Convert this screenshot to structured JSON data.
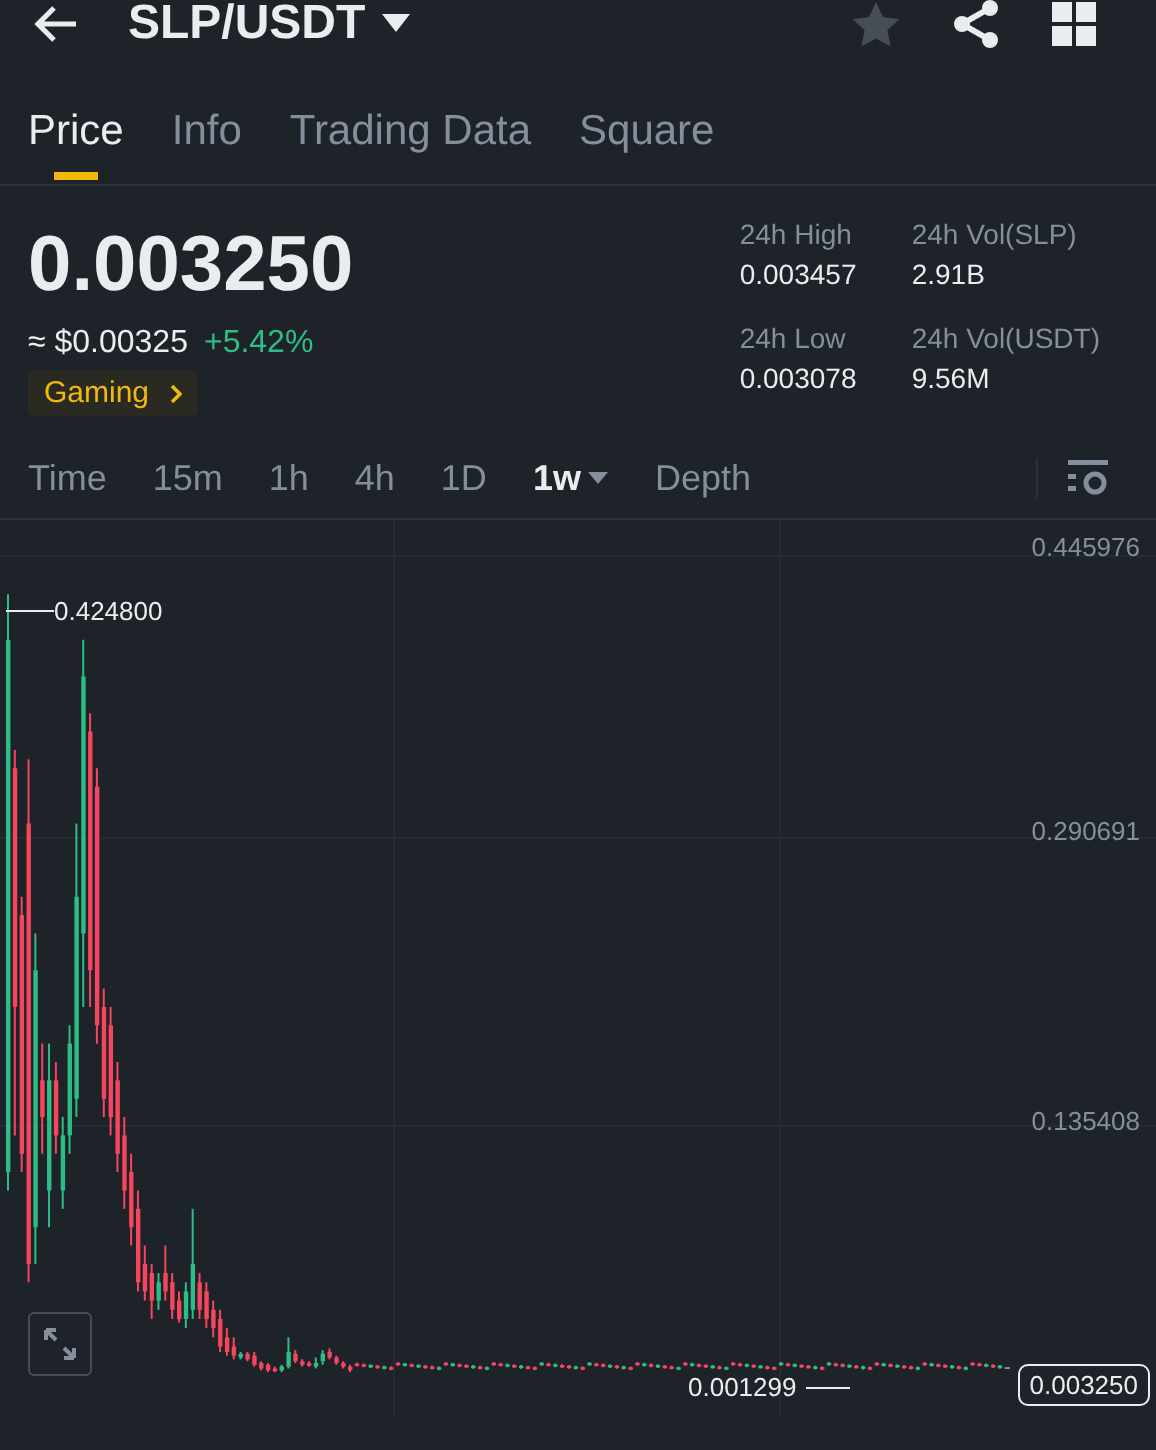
{
  "header": {
    "title": "SLP/USDT"
  },
  "tabs": [
    {
      "label": "Price",
      "selected": true
    },
    {
      "label": "Info",
      "selected": false
    },
    {
      "label": "Trading Data",
      "selected": false
    },
    {
      "label": "Square",
      "selected": false
    }
  ],
  "price": {
    "last": "0.003250",
    "fiat": "≈ $0.00325",
    "change": "+5.42%",
    "tag": "Gaming"
  },
  "stats": [
    {
      "label": "24h High",
      "value": "0.003457"
    },
    {
      "label": "24h Vol(SLP)",
      "value": "2.91B"
    },
    {
      "label": "24h Low",
      "value": "0.003078"
    },
    {
      "label": "24h Vol(USDT)",
      "value": "9.56M"
    }
  ],
  "intervals": [
    {
      "label": "Time",
      "selected": false,
      "dropdown": false
    },
    {
      "label": "15m",
      "selected": false,
      "dropdown": false
    },
    {
      "label": "1h",
      "selected": false,
      "dropdown": false
    },
    {
      "label": "4h",
      "selected": false,
      "dropdown": false
    },
    {
      "label": "1D",
      "selected": false,
      "dropdown": false
    },
    {
      "label": "1w",
      "selected": true,
      "dropdown": true
    },
    {
      "label": "Depth",
      "selected": false,
      "dropdown": false
    }
  ],
  "chart": {
    "y_labels": [
      "0.445976",
      "0.290691",
      "0.135408"
    ],
    "high_label": "0.424800",
    "low_label": "0.001299",
    "last_price": "0.003250"
  }
}
